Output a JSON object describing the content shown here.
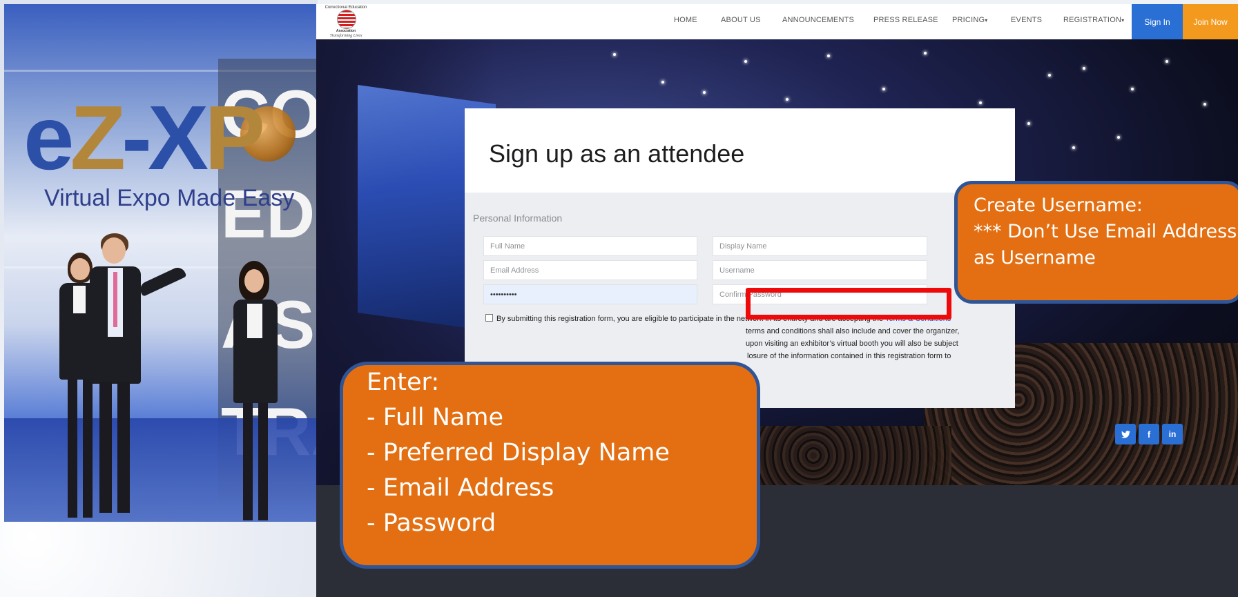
{
  "left_slide": {
    "logo_letters": {
      "e": "e",
      "z": "Z",
      "dash": "-",
      "x": "X",
      "p": "P"
    },
    "logo_tagline": "Virtual Expo Made Easy",
    "words": [
      "CO",
      "EDU",
      "ASS",
      "TRA"
    ]
  },
  "site": {
    "brand": {
      "arc_text": "Correctional Education",
      "mid_text": "Association",
      "tagline": "Transforming Lives"
    },
    "nav": {
      "items": [
        "HOME",
        "ABOUT US",
        "ANNOUNCEMENTS",
        "PRESS RELEASE",
        "PRICING",
        "EVENTS",
        "REGISTRATION"
      ],
      "caret": "▾",
      "sign_in": "Sign In",
      "join_now": "Join Now"
    },
    "form": {
      "title": "Sign up as an attendee",
      "section": "Personal Information",
      "fields": {
        "full_name": {
          "placeholder": "Full Name",
          "value": ""
        },
        "display_name": {
          "placeholder": "Display Name",
          "value": ""
        },
        "email": {
          "placeholder": "Email Address",
          "value": ""
        },
        "username": {
          "placeholder": "Username",
          "value": ""
        },
        "password": {
          "placeholder": "Password",
          "value": "••••••••••"
        },
        "confirm_password": {
          "placeholder": "Confirm Password",
          "value": ""
        }
      },
      "terms_line1_a": "By submitting this registration form, you are eligible to participate in the network in its entirety and are accepting the ",
      "terms_link": "Terms & Conditions",
      "terms_line2": "terms and conditions shall also include and cover the organizer,",
      "terms_line3": "upon visiting an exhibitor’s virtual booth you will also be subject",
      "terms_line4": "losure of the information contained in this registration form to"
    },
    "social": [
      "twitter-icon",
      "facebook-icon",
      "linkedin-icon"
    ],
    "social_glyphs": {
      "twitter": "🐦",
      "facebook": "f",
      "linkedin": "in"
    }
  },
  "callouts": {
    "username": {
      "lines": [
        "Create Username:",
        "*** Don’t Use Email Address",
        "as Username"
      ]
    },
    "enter": {
      "lines": [
        "Enter:",
        "- Full Name",
        "- Preferred Display Name",
        "- Email Address",
        "- Password"
      ]
    }
  },
  "colors": {
    "callout_fill": "#e36f12",
    "callout_border": "#2f5597",
    "highlight": "#ee0a0a",
    "sign_in": "#2a6fd4",
    "join_now": "#f39a1e"
  }
}
